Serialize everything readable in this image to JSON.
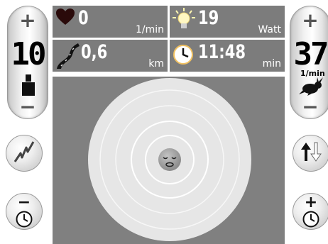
{
  "left_panel": {
    "plus_label": "+",
    "minus_label": "−",
    "value": "10",
    "weight_icon": "weight-icon"
  },
  "right_panel": {
    "plus_label": "+",
    "minus_label": "−",
    "value": "37",
    "unit": "1/min",
    "rabbit_icon": "rabbit-icon"
  },
  "stats": {
    "heart_rate": {
      "icon": "heart-icon",
      "value": "0",
      "unit": "1/min"
    },
    "power": {
      "icon": "light-bulb-icon",
      "value": "19",
      "unit": "Watt"
    },
    "distance": {
      "icon": "road-icon",
      "value": "0,6",
      "unit": "km"
    },
    "time": {
      "icon": "clock-icon",
      "value": "11:48",
      "unit": "min"
    }
  },
  "left_buttons": {
    "heart_rate_button_icon": "heartbeat-zigzag-icon",
    "time_minus_button": {
      "icon": "clock-icon",
      "label": "−"
    }
  },
  "right_buttons": {
    "direction_button_icon": "up-down-arrows-icon",
    "time_plus_button": {
      "icon": "clock-icon",
      "label": "+"
    }
  },
  "center": {
    "face_icon": "sleeping-face-icon"
  },
  "colors": {
    "tile_bg": "#7c7c7c",
    "main_bg": "#808080",
    "target_rings": "#e6e6e6",
    "face": "#9b9b9b"
  }
}
